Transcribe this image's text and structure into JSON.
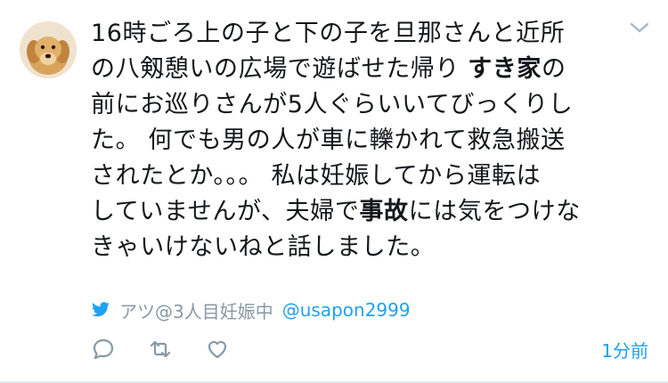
{
  "tweet": {
    "body": {
      "line1": "16時ごろ上の子と下の子を旦那さんと近所",
      "line2_pre": "の八剱憩いの広場で遊ばせた帰り ",
      "line2_bold": "すき家",
      "line2_post": "の",
      "line3": "前にお巡りさんが5人ぐらいいてびっくりし",
      "line4": "た。 何でも男の人が車に轢かれて救急搬送",
      "line5": "されたとか。。。 私は妊娠してから運転は",
      "line6_pre": "していませんが、夫婦で",
      "line6_bold": "事故",
      "line6_post": "には気をつけな",
      "line7": "きゃいけないねと話しました。"
    },
    "author": {
      "display_name": "アツ@3人目妊娠中",
      "handle": "@usapon2999"
    },
    "timestamp": "1分前",
    "icons": {
      "avatar": "dog-avatar",
      "menu": "chevron-down-icon",
      "source": "twitter-bird-icon",
      "reply": "reply-icon",
      "retweet": "retweet-icon",
      "like": "heart-icon"
    },
    "colors": {
      "accent": "#1da1f2",
      "muted": "#8899a6",
      "text": "#14171a"
    }
  }
}
